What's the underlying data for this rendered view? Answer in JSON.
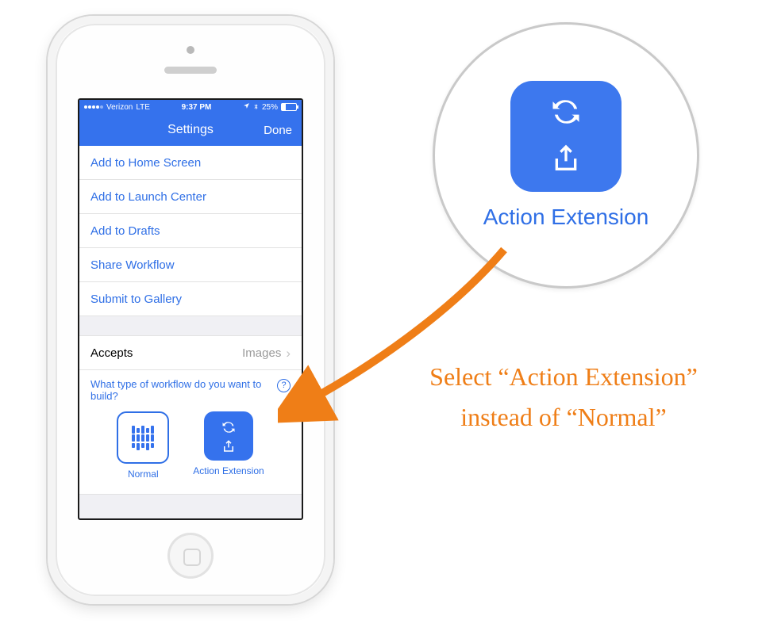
{
  "status": {
    "carrier": "Verizon",
    "network": "LTE",
    "time": "9:37 PM",
    "battery_pct": "25%"
  },
  "nav": {
    "title": "Settings",
    "done": "Done"
  },
  "list": [
    "Add to Home Screen",
    "Add to Launch Center",
    "Add to Drafts",
    "Share Workflow",
    "Submit to Gallery"
  ],
  "accepts": {
    "label": "Accepts",
    "value": "Images"
  },
  "type_q": "What type of workflow do you want to build?",
  "type_help_glyph": "?",
  "types": {
    "normal": "Normal",
    "action": "Action Extension"
  },
  "zoom_label": "Action Extension",
  "annotation": "Select “Action Extension” instead of “Normal”"
}
